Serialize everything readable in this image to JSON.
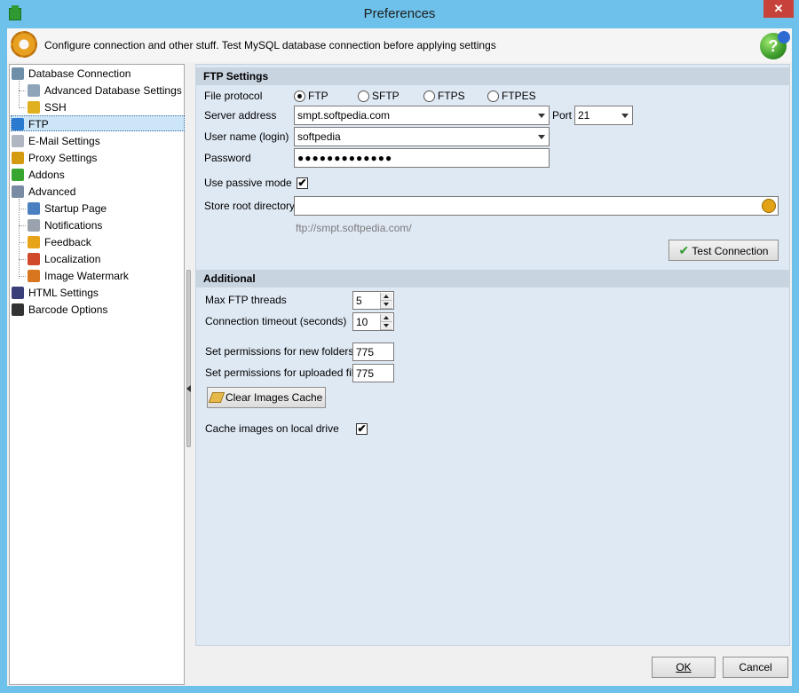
{
  "window": {
    "title": "Preferences",
    "close_glyph": "✕"
  },
  "header": {
    "text": "Configure connection and other stuff. Test MySQL database connection before applying settings"
  },
  "tree": {
    "items": [
      {
        "label": "Database Connection",
        "icon": "database-icon",
        "color": "#6f8ea8"
      },
      {
        "label": "Advanced Database Settings",
        "icon": "database-settings-icon",
        "color": "#8ea4b8"
      },
      {
        "label": "SSH",
        "icon": "lock-icon",
        "color": "#e0b020"
      },
      {
        "label": "FTP",
        "icon": "ftp-network-icon",
        "color": "#2a7bd0"
      },
      {
        "label": "E-Mail Settings",
        "icon": "envelope-icon",
        "color": "#b0b7c2"
      },
      {
        "label": "Proxy Settings",
        "icon": "proxy-icon",
        "color": "#d49a10"
      },
      {
        "label": "Addons",
        "icon": "puzzle-icon",
        "color": "#37a52f"
      },
      {
        "label": "Advanced",
        "icon": "shield-icon",
        "color": "#7a8ca4"
      },
      {
        "label": "Startup Page",
        "icon": "house-icon",
        "color": "#4a7fc0"
      },
      {
        "label": "Notifications",
        "icon": "bell-icon",
        "color": "#9aa3ad"
      },
      {
        "label": "Feedback",
        "icon": "chat-icon",
        "color": "#e7a419"
      },
      {
        "label": "Localization",
        "icon": "flag-icon",
        "color": "#d04a2a"
      },
      {
        "label": "Image Watermark",
        "icon": "image-icon",
        "color": "#d8761f"
      },
      {
        "label": "HTML Settings",
        "icon": "html-icon",
        "color": "#3a3f7a"
      },
      {
        "label": "Barcode Options",
        "icon": "barcode-icon",
        "color": "#333333"
      }
    ]
  },
  "ftp": {
    "section_title": "FTP Settings",
    "protocol_label": "File protocol",
    "protocols": [
      "FTP",
      "SFTP",
      "FTPS",
      "FTPES"
    ],
    "server_label": "Server address",
    "server_value": "smpt.softpedia.com",
    "port_label": "Port",
    "port_value": "21",
    "user_label": "User name (login)",
    "user_value": "softpedia",
    "password_label": "Password",
    "password_value": "●●●●●●●●●●●●●",
    "passive_label": "Use passive mode",
    "root_label": "Store root directory",
    "root_value": "",
    "url_hint": "ftp://smpt.softpedia.com/",
    "test_button": "Test Connection"
  },
  "additional": {
    "section_title": "Additional",
    "threads_label": "Max FTP threads",
    "threads_value": "5",
    "timeout_label": "Connection timeout (seconds)",
    "timeout_value": "10",
    "folders_label": "Set permissions for new folders",
    "folders_value": "775",
    "files_label": "Set permissions for uploaded files",
    "files_value": "775",
    "clear_cache_button": "Clear Images Cache",
    "cache_label": "Cache images on local drive"
  },
  "footer": {
    "ok": "OK",
    "cancel": "Cancel"
  },
  "checkmark": "✔",
  "help_glyph": "?"
}
